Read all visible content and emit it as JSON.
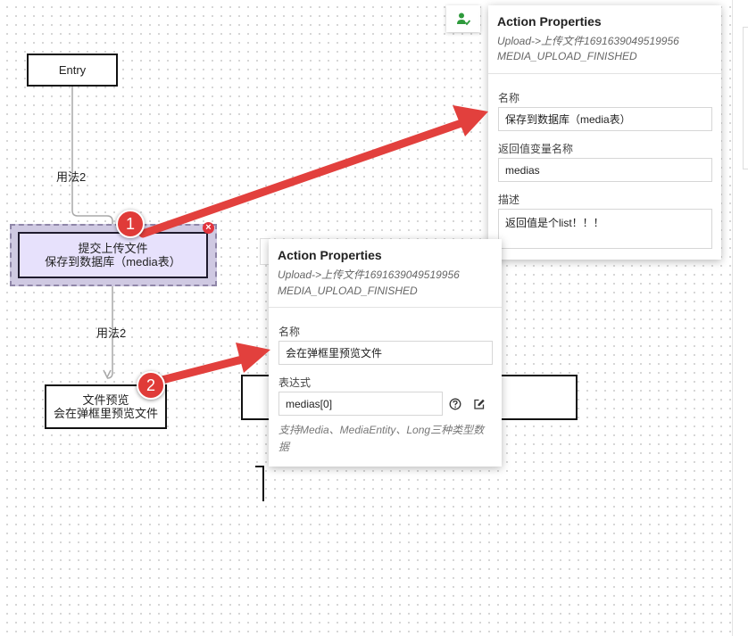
{
  "canvas": {
    "entry_label": "Entry",
    "edge1_label": "用法2",
    "edge2_label": "用法2",
    "upload_node": {
      "line1": "提交上传文件",
      "line2": "保存到数据库（media表）"
    },
    "preview_node": {
      "line1": "文件预览",
      "line2": "会在弹框里预览文件"
    },
    "close_glyph": "×"
  },
  "badges": {
    "one": "1",
    "two": "2"
  },
  "panel1": {
    "title": "Action Properties",
    "subtitle1": "Upload->上传文件1691639049519956",
    "subtitle2": "MEDIA_UPLOAD_FINISHED",
    "name_label": "名称",
    "name_value": "保存到数据库（media表）",
    "return_label": "返回值变量名称",
    "return_value": "medias",
    "desc_label": "描述",
    "desc_value": "返回值是个list！！！"
  },
  "panel2": {
    "title": "Action Properties",
    "subtitle1": "Upload->上传文件1691639049519956",
    "subtitle2": "MEDIA_UPLOAD_FINISHED",
    "name_label": "名称",
    "name_value": "会在弹框里预览文件",
    "expr_label": "表达式",
    "expr_value": "medias[0]",
    "hint": "支持Media、MediaEntity、Long三种类型数据"
  },
  "colors": {
    "arrow": "#e2403d",
    "edge": "#a8a8a8",
    "selected_fill": "#e7e1fc",
    "badge": "#e03b38",
    "user_icon": "#2e9a3c"
  },
  "icons": [
    "user-check-icon",
    "help-icon",
    "edit-icon",
    "close-icon"
  ]
}
